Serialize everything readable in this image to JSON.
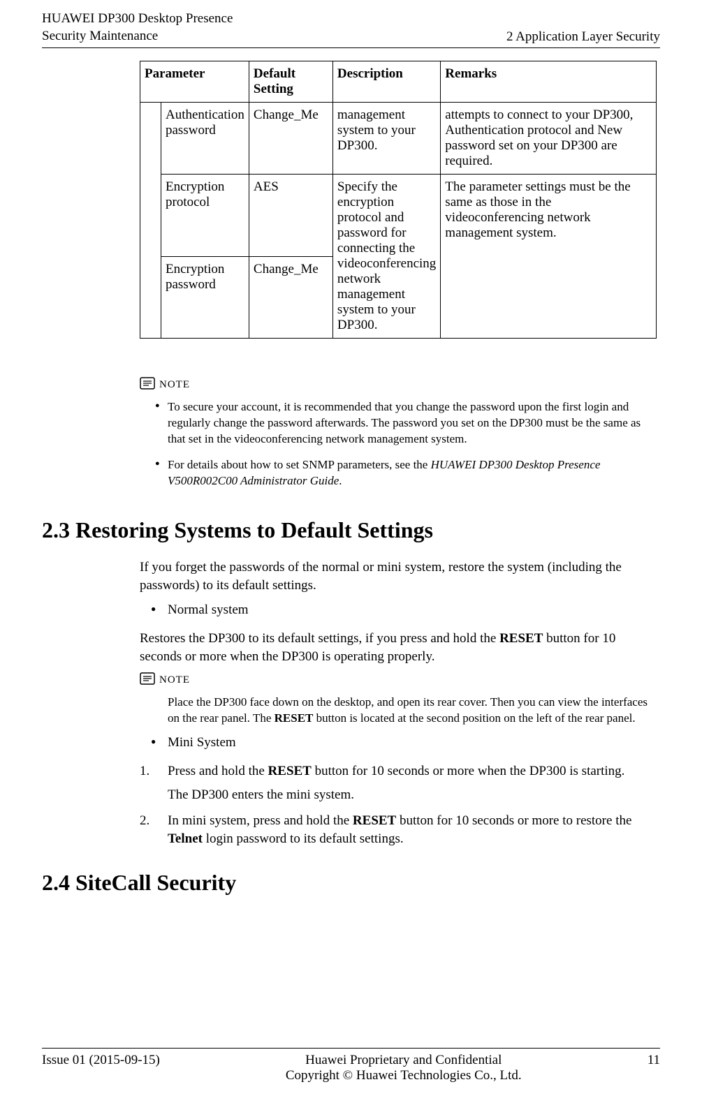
{
  "header": {
    "product_line1": "HUAWEI DP300 Desktop Presence",
    "product_line2": "Security Maintenance",
    "chapter": "2 Application Layer Security"
  },
  "table": {
    "th_parameter": "Parameter",
    "th_default": "Default Setting",
    "th_description": "Description",
    "th_remarks": "Remarks",
    "row1": {
      "param": "Authentication password",
      "default": "Change_Me",
      "desc": "management system to your DP300.",
      "remarks": "attempts to connect to your DP300, Authentication protocol and New password set on your DP300 are required."
    },
    "row2": {
      "param": "Encryption protocol",
      "default": "AES"
    },
    "row3": {
      "param": "Encryption password",
      "default": "Change_Me"
    },
    "desc_merged": "Specify the encryption protocol and password for connecting the videoconferencing network management system to your DP300.",
    "remarks_merged": "The parameter settings must be the same as those in the videoconferencing network management system."
  },
  "note1": {
    "label": "NOTE",
    "item1": "To secure your account, it is recommended that you change the password upon the first login and regularly change the password afterwards. The password you set on the DP300 must be the same as that set in the videoconferencing network management system.",
    "item2_pre": "For details about how to set SNMP parameters, see the ",
    "item2_italic": "HUAWEI DP300 Desktop Presence V500R002C00 Administrator Guide",
    "item2_post": "."
  },
  "sec23": {
    "title": "2.3 Restoring Systems to Default Settings",
    "intro": "If you forget the passwords of the normal or mini system, restore the system (including the passwords) to its default settings.",
    "bullet_normal": "Normal system",
    "normal_text_pre": "Restores the DP300 to its default settings, if you press and hold the ",
    "reset": "RESET",
    "normal_text_post": " button for 10 seconds or more when the DP300 is operating properly.",
    "note_label": "NOTE",
    "note_text_pre": "Place the DP300 face down on the desktop, and open its rear cover. Then you can view the interfaces on the rear panel. The ",
    "note_text_post": " button is located at the second position on the left of the rear panel.",
    "bullet_mini": "Mini System",
    "step1_pre": "Press and hold the ",
    "step1_post": " button for 10 seconds or more when the DP300 is starting.",
    "step1_sub": "The DP300 enters the mini system.",
    "step2_pre": "In mini system, press and hold the ",
    "step2_mid": " button for 10 seconds or more to restore the ",
    "telnet": "Telnet",
    "step2_post": " login password to its default settings."
  },
  "sec24": {
    "title": "2.4 SiteCall Security"
  },
  "footer": {
    "issue": "Issue 01 (2015-09-15)",
    "conf": "Huawei Proprietary and Confidential",
    "copy": "Copyright © Huawei Technologies Co., Ltd.",
    "page": "11"
  }
}
